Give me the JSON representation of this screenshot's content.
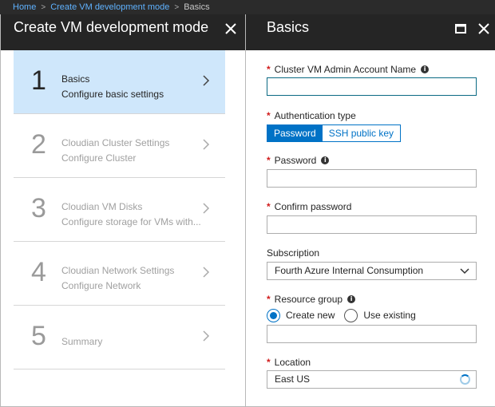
{
  "breadcrumb": {
    "items": [
      "Home",
      "Create VM development mode",
      "Basics"
    ]
  },
  "left_blade": {
    "title": "Create VM development mode",
    "steps": [
      {
        "number": "1",
        "name": "Basics",
        "description": "Configure basic settings"
      },
      {
        "number": "2",
        "name": "Cloudian Cluster Settings",
        "description": "Configure Cluster"
      },
      {
        "number": "3",
        "name": "Cloudian VM Disks",
        "description": "Configure storage for VMs with..."
      },
      {
        "number": "4",
        "name": "Cloudian Network Settings",
        "description": "Configure Network"
      },
      {
        "number": "5",
        "name": "Summary",
        "description": ""
      }
    ]
  },
  "right_blade": {
    "title": "Basics",
    "admin_account": {
      "label": "Cluster VM Admin Account Name",
      "value": ""
    },
    "auth_type": {
      "label": "Authentication type",
      "options": [
        "Password",
        "SSH public key"
      ],
      "selected": "Password"
    },
    "password": {
      "label": "Password",
      "value": ""
    },
    "confirm_password": {
      "label": "Confirm password",
      "value": ""
    },
    "subscription": {
      "label": "Subscription",
      "value": "Fourth Azure Internal Consumption"
    },
    "resource_group": {
      "label": "Resource group",
      "create_new": "Create new",
      "use_existing": "Use existing",
      "selected": "Create new",
      "value": ""
    },
    "location": {
      "label": "Location",
      "value": "East US"
    }
  },
  "colors": {
    "accent": "#0072c6",
    "active_step": "#cfe7fb",
    "header": "#252525",
    "required": "#d11b1b"
  },
  "icons": [
    "close-icon",
    "maximize-icon",
    "chevron-right-icon",
    "chevron-down-icon",
    "info-icon",
    "loading-spinner-icon"
  ]
}
